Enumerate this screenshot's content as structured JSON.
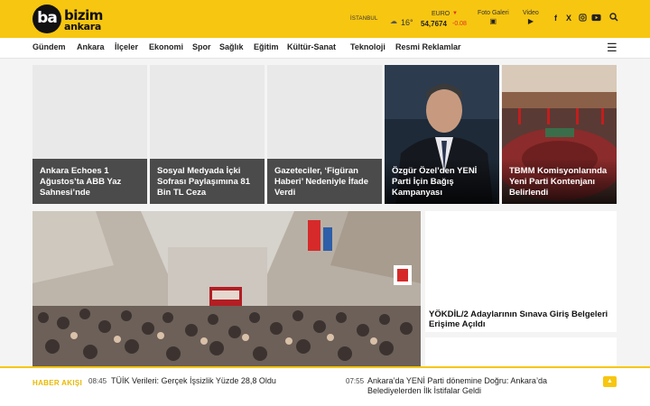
{
  "header": {
    "logo": {
      "mark": "ba",
      "word1": "bizim",
      "word2": "ankara"
    },
    "weather": {
      "city": "İSTANBUL",
      "temp": "16°",
      "icon": "cloud-icon"
    },
    "currency": {
      "label": "EURO",
      "value": "54,7674",
      "change": "-0.08",
      "trend_color": "#dd3322"
    },
    "links": [
      {
        "label": "Foto Galeri",
        "icon": "camera-icon"
      },
      {
        "label": "Video",
        "icon": "video-icon"
      }
    ],
    "social": [
      "facebook-icon",
      "x-icon",
      "instagram-icon",
      "youtube-icon",
      "search-icon"
    ],
    "accent": "#f7c611"
  },
  "nav": {
    "items": [
      "Gündem",
      "Ankara",
      "İlçeler",
      "Ekonomi",
      "Spor",
      "Sağlık",
      "Eğitim",
      "Kültür-Sanat",
      "Teknoloji",
      "Resmi Reklamlar"
    ],
    "menu_icon": "menu-icon"
  },
  "cards": [
    {
      "title": "Ankara Echoes 1 Ağustos’ta ABB Yaz Sahnesi’nde"
    },
    {
      "title": "Sosyal Medyada İçki Sofrası Paylaşımına 81 Bin TL Ceza"
    },
    {
      "title": "Gazeteciler, ‘Figüran Haberi’ Nedeniyle İfade Verdi"
    },
    {
      "title": "Özgür Özel’den YENİ Parti İçin Bağış Kampanyası"
    },
    {
      "title": "TBMM Komisyonlarında Yeni Parti Kontenjanı Belirlendi"
    }
  ],
  "side": {
    "title": "YÖKDİL/2 Adaylarının Sınava Giriş Belgeleri Erişime Açıldı"
  },
  "ticker": {
    "label": "HABER AKIŞI",
    "items": [
      {
        "time": "08:45",
        "text": "TÜİK Verileri: Gerçek İşsizlik Yüzde 28,8 Oldu"
      },
      {
        "time": "07:55",
        "text": "Ankara’da YENİ Parti dönemine Doğru: Ankara’da Belediyelerden İlk İstifalar Geldi"
      }
    ]
  }
}
